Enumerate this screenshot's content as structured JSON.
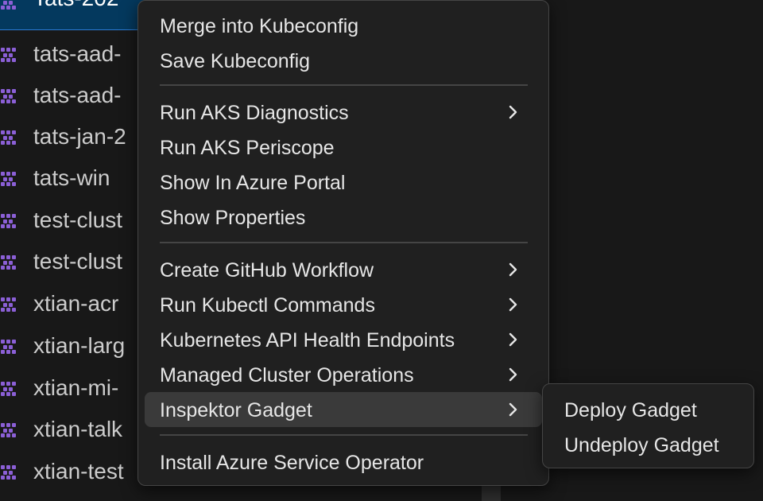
{
  "colors": {
    "cluster_icon": "#8b5fd6",
    "selected_row": "#04395e",
    "menu_bg": "#202020",
    "menu_highlight": "#3a3a3a"
  },
  "tree": {
    "icon": "kubernetes-cluster-icon",
    "items": [
      {
        "label": "Tats-202"
      },
      {
        "label": "tats-aad-"
      },
      {
        "label": "tats-aad-"
      },
      {
        "label": "tats-jan-2"
      },
      {
        "label": "tats-win"
      },
      {
        "label": "test-clust"
      },
      {
        "label": "test-clust"
      },
      {
        "label": "xtian-acr"
      },
      {
        "label": "xtian-larg"
      },
      {
        "label": "xtian-mi-"
      },
      {
        "label": "xtian-talk"
      },
      {
        "label": "xtian-test"
      }
    ]
  },
  "context_menu": {
    "groups": [
      {
        "items": [
          {
            "label": "Merge into Kubeconfig",
            "submenu": false
          },
          {
            "label": "Save Kubeconfig",
            "submenu": false
          }
        ]
      },
      {
        "items": [
          {
            "label": "Run AKS Diagnostics",
            "submenu": true
          },
          {
            "label": "Run AKS Periscope",
            "submenu": false
          },
          {
            "label": "Show In Azure Portal",
            "submenu": false
          },
          {
            "label": "Show Properties",
            "submenu": false
          }
        ]
      },
      {
        "items": [
          {
            "label": "Create GitHub Workflow",
            "submenu": true
          },
          {
            "label": "Run Kubectl Commands",
            "submenu": true
          },
          {
            "label": "Kubernetes API Health Endpoints",
            "submenu": true
          },
          {
            "label": "Managed Cluster Operations",
            "submenu": true
          },
          {
            "label": "Inspektor Gadget",
            "submenu": true,
            "active": true
          }
        ]
      },
      {
        "items": [
          {
            "label": "Install Azure Service Operator",
            "submenu": false
          }
        ]
      }
    ]
  },
  "submenu": {
    "items": [
      {
        "label": "Deploy Gadget"
      },
      {
        "label": "Undeploy Gadget"
      }
    ]
  }
}
